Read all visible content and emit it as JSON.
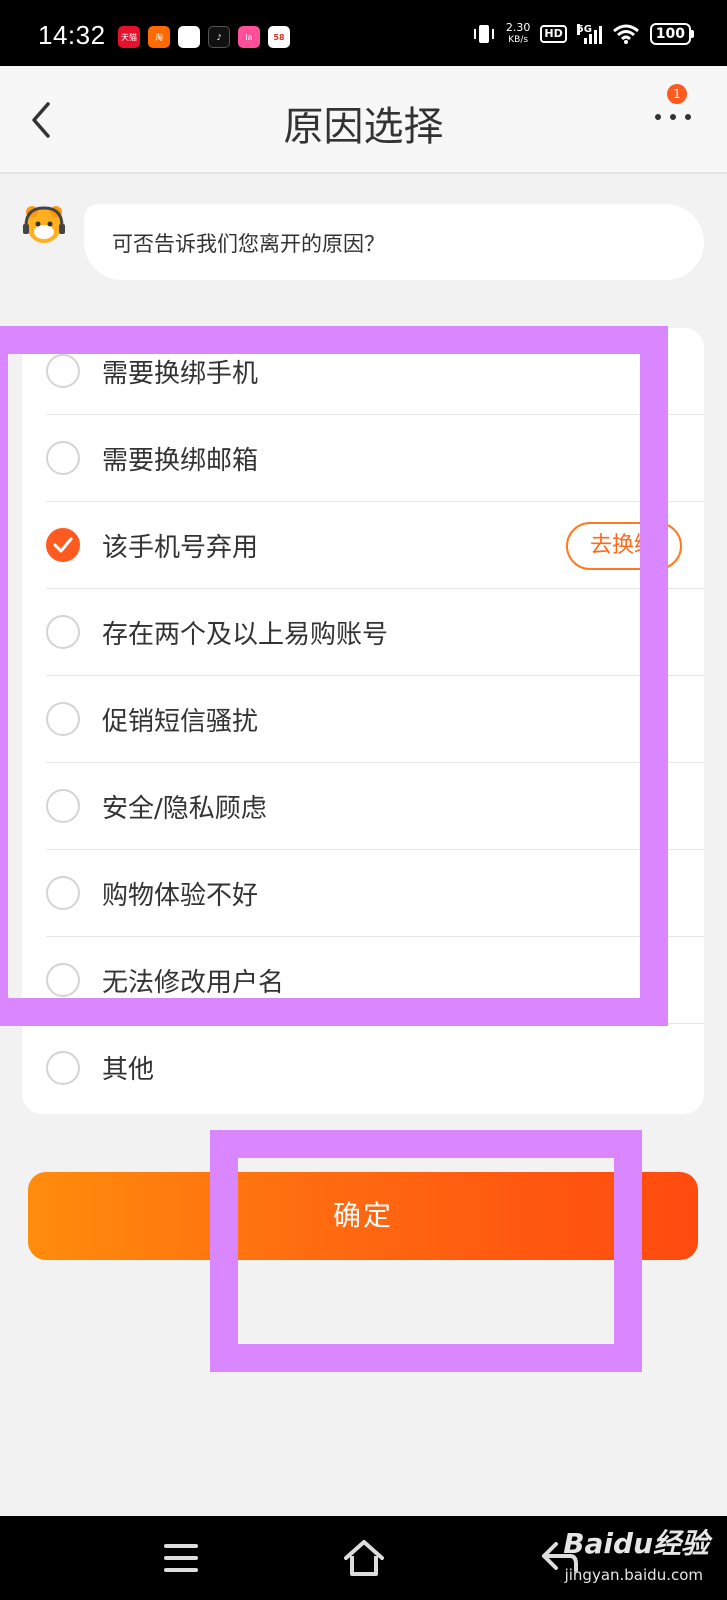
{
  "status_bar": {
    "time": "14:32",
    "network_speed_value": "2.30",
    "network_speed_unit": "KB/s",
    "hd": "HD",
    "network": "5G",
    "battery": "100",
    "app_icons": [
      {
        "label": "天猫",
        "color": "#e8112d"
      },
      {
        "label": "淘",
        "color": "#ff6a00"
      },
      {
        "label": "",
        "color": "#ffffff"
      },
      {
        "label": "♪",
        "color": "#111111"
      },
      {
        "label": "la",
        "color": "#ff4f9a"
      },
      {
        "label": "58",
        "color": "#ffb400"
      }
    ]
  },
  "header": {
    "title": "原因选择",
    "badge": "1"
  },
  "chat": {
    "message": "可否告诉我们您离开的原因？"
  },
  "options": [
    {
      "label": "需要换绑手机",
      "checked": false
    },
    {
      "label": "需要换绑邮箱",
      "checked": false
    },
    {
      "label": "该手机号弃用",
      "checked": true,
      "action": "去换绑"
    },
    {
      "label": "存在两个及以上易购账号",
      "checked": false
    },
    {
      "label": "促销短信骚扰",
      "checked": false
    },
    {
      "label": "安全/隐私顾虑",
      "checked": false
    },
    {
      "label": "购物体验不好",
      "checked": false
    },
    {
      "label": "无法修改用户名",
      "checked": false
    },
    {
      "label": "其他",
      "checked": false
    }
  ],
  "confirm_label": "确定",
  "colors": {
    "accent": "#ff5a1f",
    "highlight": "#d986ff"
  },
  "watermark": {
    "brand": "Baidu经验",
    "url": "jingyan.baidu.com"
  }
}
